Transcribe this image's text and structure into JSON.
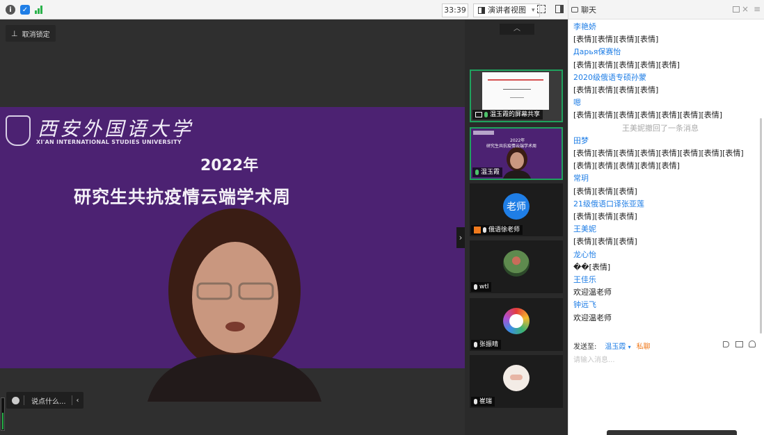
{
  "toolbar": {
    "timer": "33:39",
    "view_label": "演讲者视图",
    "view_arrow": "▾"
  },
  "main": {
    "unpin_label": "取消锁定",
    "slide": {
      "logo_cn": "西安外国语大学",
      "logo_en": "XI'AN INTERNATIONAL STUDIES UNIVERSITY",
      "year": "2022年",
      "title": "研究生共抗疫情云端学术周"
    },
    "input_placeholder": "说点什么...",
    "collapse_arrow": "‹",
    "expand_arrow": "›"
  },
  "gallery": {
    "up_arrow": "︿",
    "tiles": [
      {
        "name": "温玉霞的屏幕共享"
      },
      {
        "name": "温玉霞"
      },
      {
        "name": "俄语徐老师",
        "avatar_text": "老师"
      },
      {
        "name": "wtl"
      },
      {
        "name": "张振晴"
      },
      {
        "name": "崔瑞"
      }
    ],
    "thumb_slide_title": "研究生共抗疫情云端学术周",
    "thumb_year": "2022年"
  },
  "chat": {
    "title": "聊天",
    "messages": [
      {
        "sender": "李艳娇",
        "text": "[表情][表情][表情][表情]"
      },
      {
        "sender": "Дарья保赛怡",
        "text": "[表情][表情][表情][表情][表情]"
      },
      {
        "sender": "2020级俄语专硕孙蒙",
        "text": "[表情][表情][表情][表情]"
      },
      {
        "sender": "嗯",
        "text": "[表情][表情][表情][表情][表情][表情][表情]"
      },
      {
        "system": "王美妮撤回了一条消息"
      },
      {
        "sender": "田梦",
        "text": "[表情][表情][表情][表情][表情][表情][表情][表情][表情][表情][表情][表情][表情]"
      },
      {
        "sender": "常玥",
        "text": "[表情][表情][表情]"
      },
      {
        "sender": "21级俄语口译张亚莲",
        "text": "[表情][表情][表情]"
      },
      {
        "sender": "王美妮",
        "text": "[表情][表情][表情]"
      },
      {
        "sender": "龙心怡",
        "text": "��[表情]"
      },
      {
        "sender": "王佳乐",
        "text": "欢迎温老师"
      },
      {
        "sender": "钟远飞",
        "text": "欢迎温老师"
      }
    ],
    "send_to_label": "发送至:",
    "recipient": "温玉霞",
    "recipient_arrow": "▾",
    "private_label": "私聊",
    "compose_placeholder": "请输入消息..."
  },
  "colors": {
    "accent_blue": "#1f7ee6",
    "slide_purple": "#4c2272",
    "private_orange": "#f07a1d",
    "speaking_green": "#1fa25e"
  }
}
